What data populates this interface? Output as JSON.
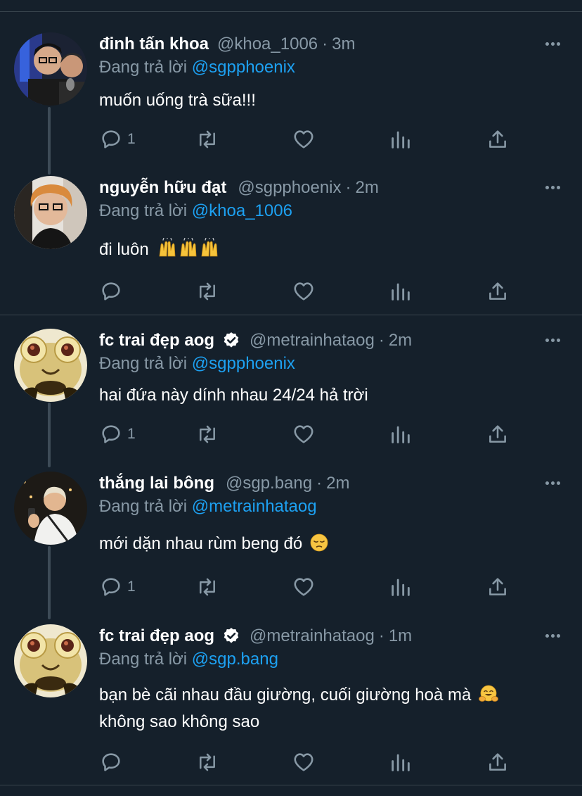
{
  "colors": {
    "background": "#15202b",
    "divider": "#38444d",
    "muted_text": "#8899a6",
    "mention": "#1da1f2",
    "verified": "#ffffff"
  },
  "reply_prefix": "Đang trả lời",
  "tweets": [
    {
      "name": "đinh tấn khoa",
      "handle": "@khoa_1006",
      "time": "3m",
      "reply_to": "@sgpphoenix",
      "text": "muốn uống trà sữa!!!",
      "text2": "",
      "reply_count": "1",
      "verified": false,
      "emoji": ""
    },
    {
      "name": "nguyễn hữu đạt",
      "handle": "@sgpphoenix",
      "time": "2m",
      "reply_to": "@khoa_1006",
      "text": "đi luôn",
      "text2": "",
      "reply_count": "",
      "verified": false,
      "emoji": "raising-hands x3"
    },
    {
      "name": "fc trai đẹp aog",
      "handle": "@metrainhataog",
      "time": "2m",
      "reply_to": "@sgpphoenix",
      "text": "hai đứa này dính nhau 24/24 hả trời",
      "text2": "",
      "reply_count": "1",
      "verified": true,
      "emoji": ""
    },
    {
      "name": "thắng lai bông",
      "handle": "@sgp.bang",
      "time": "2m",
      "reply_to": "@metrainhataog",
      "text": "mới dặn nhau rùm beng đó",
      "text2": "",
      "reply_count": "1",
      "verified": false,
      "emoji": "pensive-face"
    },
    {
      "name": "fc trai đẹp aog",
      "handle": "@metrainhataog",
      "time": "1m",
      "reply_to": "@sgp.bang",
      "text": "bạn bè cãi nhau đầu giường, cuối giường hoà mà",
      "text2": "không sao không sao",
      "reply_count": "",
      "verified": true,
      "emoji": "hugging-face"
    }
  ]
}
